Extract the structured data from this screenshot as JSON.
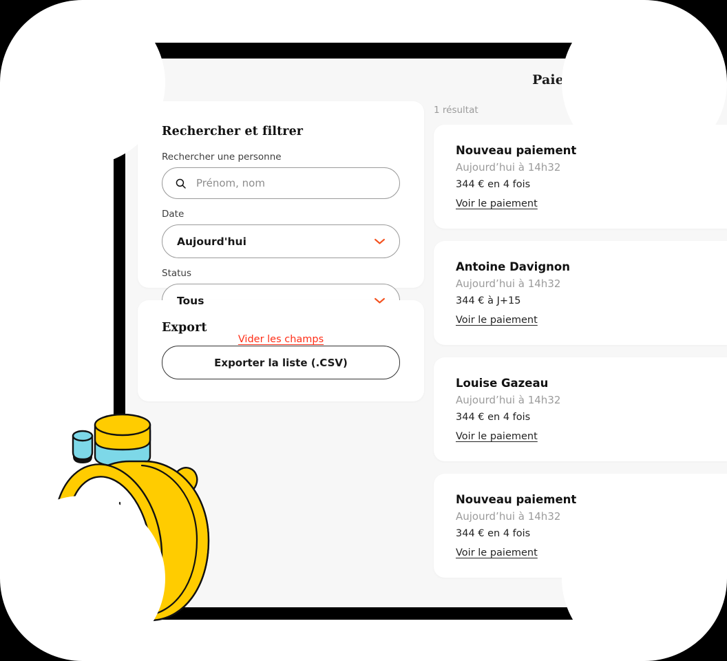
{
  "header": {
    "title": "Paiements"
  },
  "filters": {
    "title": "Rechercher et filtrer",
    "search_label": "Rechercher une personne",
    "search_placeholder": "Prénom, nom",
    "search_value": "",
    "search_icon": "search-icon",
    "date_label": "Date",
    "date_value": "Aujourd'hui",
    "status_label": "Status",
    "status_value": "Tous",
    "chevron_icon": "chevron-down-icon",
    "clear_link": "Vider les champs"
  },
  "export": {
    "title": "Export",
    "button_label": "Exporter la liste (.CSV)"
  },
  "results": {
    "count_label": "1 résultat",
    "items": [
      {
        "name": "Nouveau paiement",
        "when": "Aujourd’hui à 14h32",
        "amount": "344 € en 4 fois",
        "link": "Voir le paiement"
      },
      {
        "name": "Antoine Davignon",
        "when": "Aujourd’hui à 14h32",
        "amount": "344 € à J+15",
        "link": "Voir le paiement"
      },
      {
        "name": "Louise Gazeau",
        "when": "Aujourd’hui à 14h32",
        "amount": "344 € en 4 fois",
        "link": "Voir le paiement"
      },
      {
        "name": "Nouveau paiement",
        "when": "Aujourd’hui à 14h32",
        "amount": "344 € en 4 fois",
        "link": "Voir le paiement"
      }
    ]
  },
  "illustration": {
    "name": "stopwatch-illustration",
    "body_color": "#FFCC00",
    "button_color": "#7DD8E8",
    "face_color": "#FFFFFF",
    "outline_color": "#111111"
  },
  "colors": {
    "accent_red": "#FF2D16",
    "chevron_orange": "#F4511E",
    "screen_background": "#F7F7F7",
    "card_background": "#FFFFFF",
    "frame_black": "#000000"
  }
}
